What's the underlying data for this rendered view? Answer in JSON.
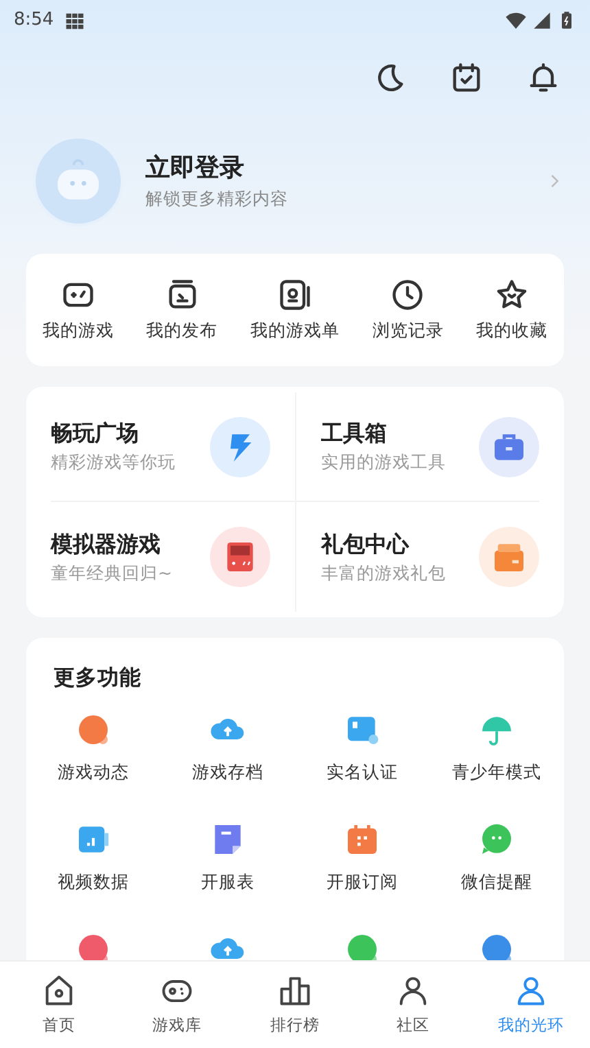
{
  "status_bar": {
    "time": "8:54"
  },
  "login": {
    "title": "立即登录",
    "subtitle": "解锁更多精彩内容"
  },
  "shortcuts": [
    {
      "label": "我的游戏",
      "kind": "gamepad"
    },
    {
      "label": "我的发布",
      "kind": "publish"
    },
    {
      "label": "我的游戏单",
      "kind": "list"
    },
    {
      "label": "浏览记录",
      "kind": "clock"
    },
    {
      "label": "我的收藏",
      "kind": "star"
    }
  ],
  "entries": [
    {
      "title": "畅玩广场",
      "subtitle": "精彩游戏等你玩",
      "kind": "play",
      "color": "#2f8ff0"
    },
    {
      "title": "工具箱",
      "subtitle": "实用的游戏工具",
      "kind": "toolbox",
      "color": "#5a7ce8"
    },
    {
      "title": "模拟器游戏",
      "subtitle": "童年经典回归~",
      "kind": "console",
      "color": "#e8504c"
    },
    {
      "title": "礼包中心",
      "subtitle": "丰富的游戏礼包",
      "kind": "gift",
      "color": "#f5873a"
    }
  ],
  "more": {
    "title": "更多功能",
    "items": [
      {
        "label": "游戏动态",
        "kind": "blob",
        "color": "#f47a45"
      },
      {
        "label": "游戏存档",
        "kind": "cloud",
        "color": "#3aa7ee"
      },
      {
        "label": "实名认证",
        "kind": "card",
        "color": "#3aa7ee"
      },
      {
        "label": "青少年模式",
        "kind": "umbrella",
        "color": "#2fc7a5"
      },
      {
        "label": "视频数据",
        "kind": "chart",
        "color": "#3aa7ee"
      },
      {
        "label": "开服表",
        "kind": "note",
        "color": "#6f7cf0"
      },
      {
        "label": "开服订阅",
        "kind": "calendar",
        "color": "#f47a45"
      },
      {
        "label": "微信提醒",
        "kind": "chat",
        "color": "#3cc45a"
      },
      {
        "kind": "blob",
        "color": "#ef5b6a"
      },
      {
        "kind": "cloud",
        "color": "#3aa7ee"
      },
      {
        "kind": "blob",
        "color": "#3cc45a"
      },
      {
        "kind": "blob",
        "color": "#3a8ee8"
      }
    ]
  },
  "tabs": [
    {
      "label": "首页",
      "kind": "home",
      "selected": false
    },
    {
      "label": "游戏库",
      "kind": "gamepad",
      "selected": false
    },
    {
      "label": "排行榜",
      "kind": "rank",
      "selected": false
    },
    {
      "label": "社区",
      "kind": "community",
      "selected": false
    },
    {
      "label": "我的光环",
      "kind": "me",
      "selected": true
    }
  ]
}
